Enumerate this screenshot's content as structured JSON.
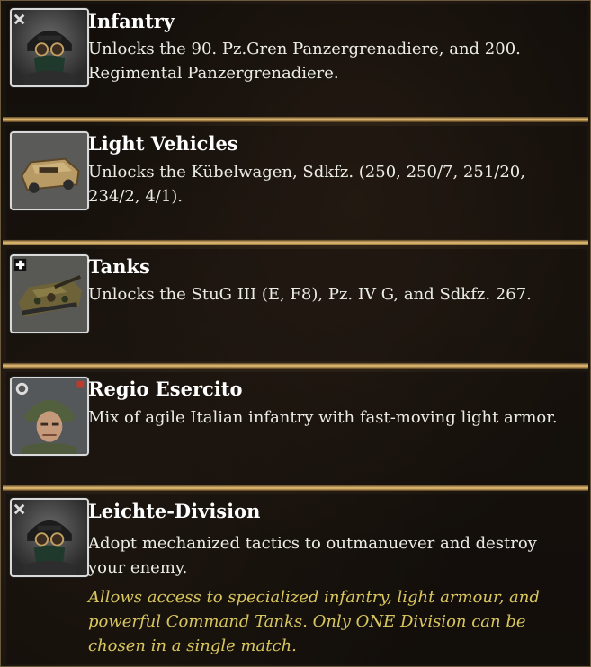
{
  "items": [
    {
      "icon": "infantry-officer-icon",
      "title": "Infantry",
      "description": "Unlocks the 90. Pz.Gren Panzergrenadiere, and 200. Regimental Panzergrenadiere."
    },
    {
      "icon": "light-vehicle-icon",
      "title": "Light Vehicles",
      "description": "Unlocks the Kübelwagen, Sdkfz. (250, 250/7, 251/20, 234/2, 4/1)."
    },
    {
      "icon": "tank-icon",
      "title": "Tanks",
      "description": "Unlocks the StuG III (E, F8), Pz. IV G, and Sdkfz. 267."
    },
    {
      "icon": "italian-soldier-icon",
      "title": "Regio Esercito",
      "description": "Mix of agile Italian infantry with fast-moving light armor."
    },
    {
      "icon": "infantry-officer-icon",
      "title": "Leichte-Division",
      "description": "Adopt mechanized tactics to outmanuever and destroy your enemy.",
      "note": "Allows access to specialized infantry, light armour, and powerful Command Tanks. Only ONE Division can be chosen in a single match."
    }
  ],
  "colors": {
    "title": "#ffffff",
    "description": "#ecece6",
    "note": "#d8c65e",
    "divider": "#c9a561"
  }
}
